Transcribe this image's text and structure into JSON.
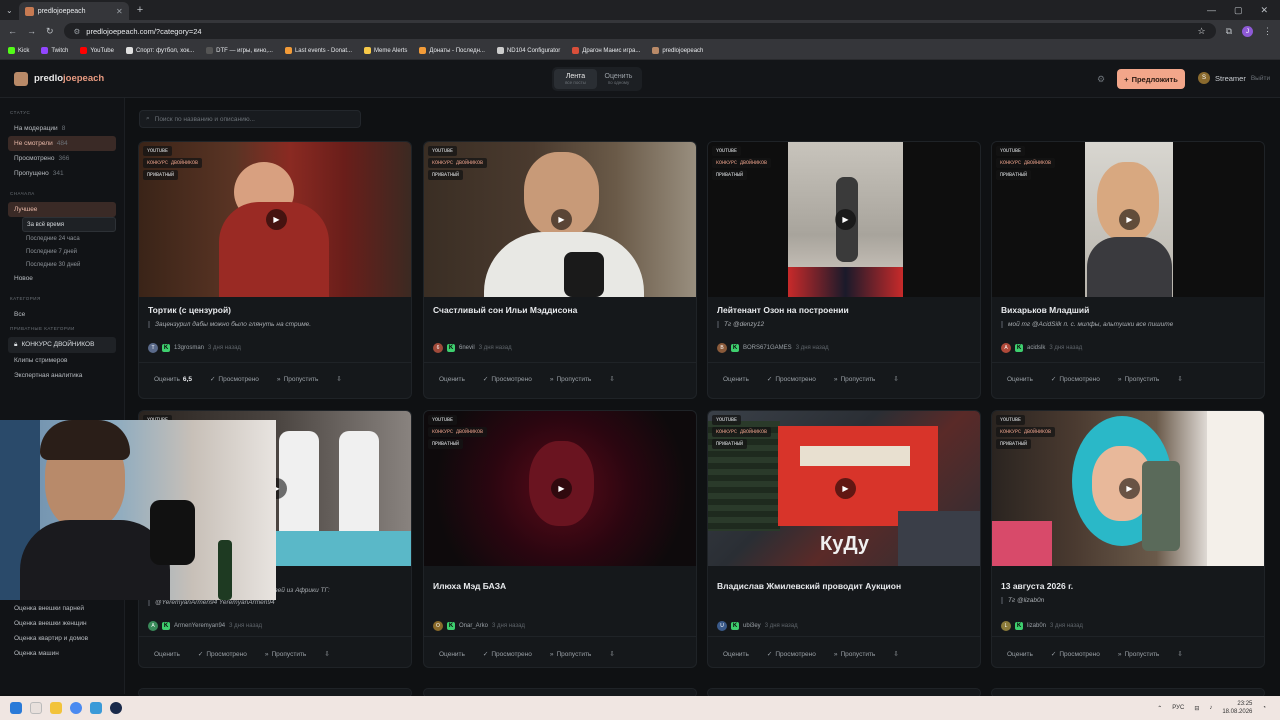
{
  "browser": {
    "tab_title": "predlojoepeach",
    "url": "predlojoepeach.com/?category=24",
    "profile_initial": "J",
    "bookmarks": [
      "Kick",
      "Twitch",
      "YouTube",
      "Спорт: футбол, хок...",
      "DTF — игры, кино,...",
      "Last events - Donat...",
      "Meme Alerts",
      "Донаты - Последн...",
      "ND104 Configurator",
      "Драгон Манис игра...",
      "predlojoepeach"
    ]
  },
  "header": {
    "logo_prefix": "predlo",
    "logo_suffix": "joepeach",
    "tabs": [
      {
        "label": "Лента",
        "sub": "все посты"
      },
      {
        "label": "Оценить",
        "sub": "по одному"
      }
    ],
    "suggest_label": "Предложить",
    "user_initial": "S",
    "user_name": "Streamer",
    "logout_label": "Выйти"
  },
  "sidebar": {
    "status_title": "СТАТУС",
    "status_items": [
      {
        "label": "На модерации",
        "count": "8"
      },
      {
        "label": "Не смотрели",
        "count": "484"
      },
      {
        "label": "Просмотрено",
        "count": "366"
      },
      {
        "label": "Пропущено",
        "count": "341"
      }
    ],
    "sort_title": "СНАЧАЛА",
    "sort_best": "Лучшее",
    "sort_sub": [
      "За всё время",
      "Последние 24 часа",
      "Последние 7 дней",
      "Последние 30 дней"
    ],
    "sort_new": "Новое",
    "cat_title": "КАТЕГОРИЯ",
    "cat_all": "Все",
    "private_title": "ПРИВАТНЫЕ КАТЕГОРИИ",
    "private_item": "КОНКУРС ДВОЙНИКОВ",
    "categories": [
      "Клипы стримеров",
      "Экспертная аналитика"
    ],
    "bottom_categories": [
      "Оценка внешки парней",
      "Оценка внешки женщин",
      "Оценка квартир и домов",
      "Оценка машин"
    ]
  },
  "search": {
    "placeholder": "Поиск по названию и описанию..."
  },
  "badges": {
    "source": "YOUTUBE",
    "contest": "КОНКУРС ДВОЙНИКОВ",
    "private": "ПРИВАТНЫЙ"
  },
  "actions": {
    "rate": "Оценить",
    "viewed": "Просмотрено",
    "skip": "Пропустить"
  },
  "cards": [
    {
      "title": "Тортик (с цензурой)",
      "desc": "Зацензурил дабы можно было глянуть на стриме.",
      "author": "13grosman",
      "initial": "T",
      "time": "3 дня назад",
      "score": "6,5"
    },
    {
      "title": "Счастливый сон Ильи Мэддисона",
      "desc": "",
      "author": "6nevil",
      "initial": "6",
      "time": "3 дня назад",
      "score": ""
    },
    {
      "title": "Лейтенант Озон на построении",
      "desc": "Тг @denzy12",
      "author": "BORS671GAMES",
      "initial": "B",
      "time": "3 дня назад",
      "score": ""
    },
    {
      "title": "Вихарьков Младший",
      "desc": "мой тг @AcidSilk п. с. милфы, альтушки все пишите",
      "author": "acidslk",
      "initial": "A",
      "time": "3 дня назад",
      "score": ""
    },
    {
      "title": "",
      "desc": "@YeremyanArmen94 YeremyanArmen94",
      "desc_tail": "рузей из Африки ТГ:",
      "author": "ArmenYeremyan94",
      "initial": "A",
      "time": "3 дня назад",
      "score": ""
    },
    {
      "title": "Илюха Мэд БАЗА",
      "desc": "",
      "author": "Onar_Arko",
      "initial": "O",
      "time": "3 дня назад",
      "score": ""
    },
    {
      "title": "Владислав Жмилевский проводит Аукцион",
      "desc": "",
      "author": "ubi3ey",
      "initial": "U",
      "time": "3 дня назад",
      "score": ""
    },
    {
      "title": "13 августа 2026 г.",
      "desc": "Тг @lizab0n",
      "author": "lizab0n",
      "initial": "L",
      "time": "3 дня назад",
      "score": ""
    }
  ],
  "thumb_overlay_text": "КуДу",
  "taskbar": {
    "lang": "РУС",
    "time": "23:25",
    "date": "18.08.2026"
  },
  "colors": {
    "accent": "#f2a68a",
    "kick_green": "#3ecf6e",
    "bg": "#0f1113"
  }
}
